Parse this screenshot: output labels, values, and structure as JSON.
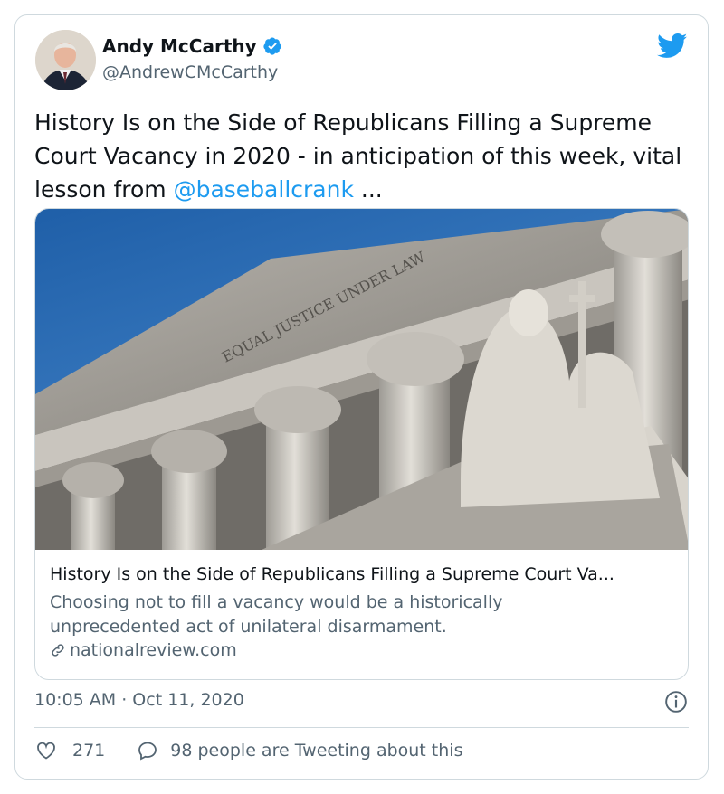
{
  "author": {
    "display_name": "Andy McCarthy",
    "handle": "@AndrewCMcCarthy",
    "verified": true,
    "avatar_icon": "avatar-photo"
  },
  "tweet": {
    "text_before": "History Is on the Side of Republicans Filling a Supreme Court Vacancy in 2020 -  in anticipation of this week, vital lesson from ",
    "mention": "@baseballcrank",
    "text_after": " ..."
  },
  "link_card": {
    "image_icon": "supreme-court-photo",
    "title": "History Is on the Side of Republicans Filling a Supreme Court Va...",
    "description": "Choosing not to fill a vacancy would be a historically unprecedented act of unilateral disarmament.",
    "domain": "nationalreview.com"
  },
  "meta": {
    "timestamp": "10:05 AM · Oct 11, 2020"
  },
  "actions": {
    "likes": "271",
    "replies_label": "98 people are Tweeting about this"
  },
  "colors": {
    "accent": "#1d9bf0",
    "text": "#0f1419",
    "secondary": "#536471",
    "border": "#cfd9de"
  },
  "image_text": "EQUAL JUSTICE UNDER LAW"
}
